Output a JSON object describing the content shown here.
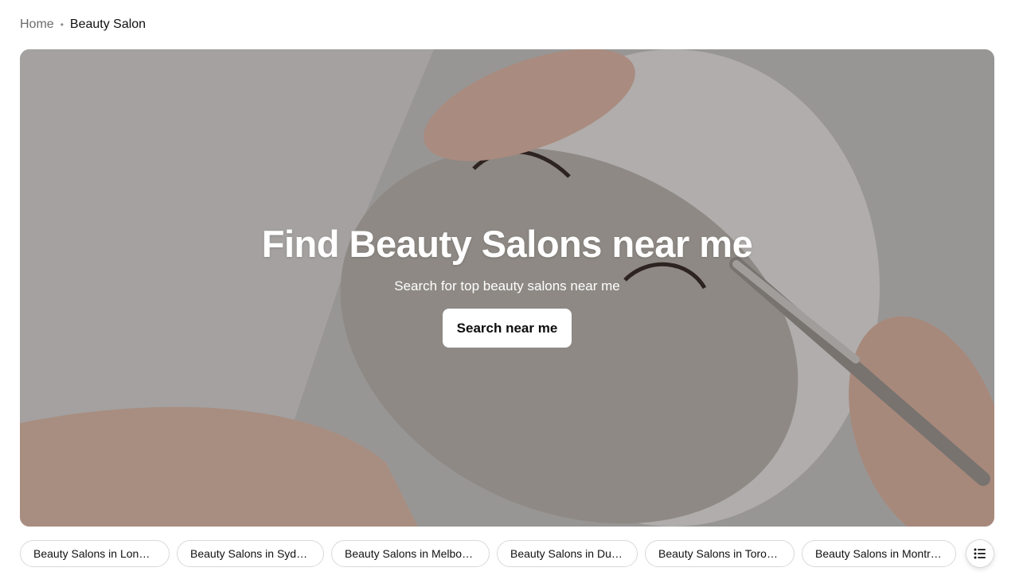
{
  "breadcrumb": {
    "home": "Home",
    "separator": "•",
    "current": "Beauty Salon"
  },
  "hero": {
    "title": "Find Beauty Salons near me",
    "subtitle": "Search for top beauty salons near me",
    "button": "Search near me"
  },
  "chips": [
    "Beauty Salons in London",
    "Beauty Salons in Sydney",
    "Beauty Salons in Melbou...",
    "Beauty Salons in Dubai",
    "Beauty Salons in Toronto",
    "Beauty Salons in Montréal"
  ],
  "icons": {
    "more": "list-icon"
  }
}
